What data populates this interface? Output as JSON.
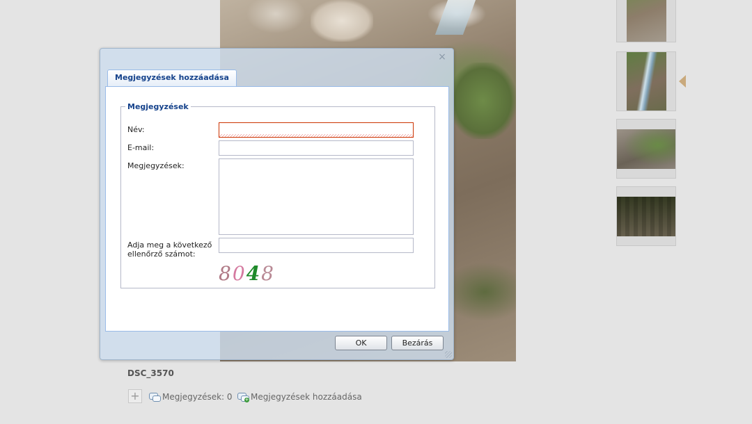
{
  "photo": {
    "name": "DSC_3570"
  },
  "thumbnails": [
    {
      "id": "thumb-1"
    },
    {
      "id": "thumb-2"
    },
    {
      "id": "thumb-3"
    },
    {
      "id": "thumb-4"
    }
  ],
  "info": {
    "title": "DSC_3570",
    "add_button": "+",
    "comments_count_label": "Megjegyzések: 0",
    "add_comments_label": "Megjegyzések hozzáadása"
  },
  "dialog": {
    "close_icon": "×",
    "tab_label": "Megjegyzések hozzáadása",
    "fieldset_legend": "Megjegyzések",
    "fields": {
      "name_label": "Név:",
      "name_value": "",
      "email_label": "E-mail:",
      "email_value": "",
      "comments_label": "Megjegyzések:",
      "comments_value": "",
      "captcha_label": "Adja meg a következő ellenőrző számot:",
      "captcha_value": ""
    },
    "captcha_digits": [
      "8",
      "0",
      "4",
      "8"
    ],
    "buttons": {
      "ok": "OK",
      "close": "Bezárás"
    }
  },
  "colors": {
    "accent": "#15428b",
    "invalid_border": "#cc3300",
    "dialog_bg": "#cdddee"
  },
  "icons": {
    "close": "close-icon",
    "comments": "comments-bubble-icon",
    "add_comment": "add-comment-icon",
    "next_arrow": "arrow-left-icon"
  }
}
